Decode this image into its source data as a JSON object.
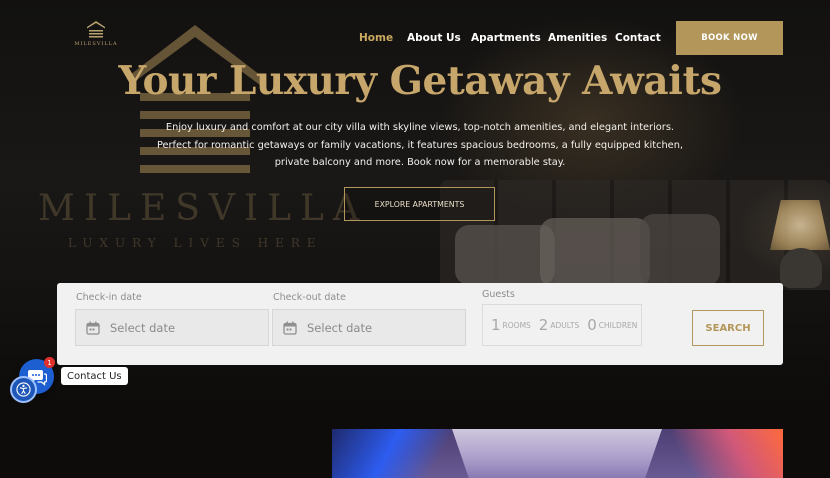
{
  "brand": {
    "logo_text": "MILESVILLA"
  },
  "nav": {
    "items": [
      {
        "label": "Home",
        "active": true
      },
      {
        "label": "About Us"
      },
      {
        "label": "Apartments"
      },
      {
        "label": "Amenities"
      },
      {
        "label": "Contact"
      }
    ],
    "book_label": "BOOK NOW"
  },
  "hero": {
    "title": "Your Luxury Getaway Awaits",
    "description": "Enjoy luxury and comfort at our city villa with skyline views, top-notch amenities, and elegant interiors. Perfect for romantic getaways or family vacations, it features spacious bedrooms, a fully equipped kitchen, private balcony and more. Book now for a memorable stay.",
    "explore_label": "EXPLORE APARTMENTS",
    "watermark": "MILESVILLA",
    "watermark_tagline": "LUXURY LIVES HERE"
  },
  "booking": {
    "checkin": {
      "label": "Check-in date",
      "placeholder": "Select date"
    },
    "checkout": {
      "label": "Check-out date",
      "placeholder": "Select date"
    },
    "guests": {
      "label": "Guests",
      "rooms": {
        "count": "1",
        "label": "ROOMS"
      },
      "adults": {
        "count": "2",
        "label": "ADULTS"
      },
      "children": {
        "count": "0",
        "label": "CHILDREN"
      }
    },
    "search_label": "SEARCH"
  },
  "chat": {
    "badge_count": "1",
    "tooltip": "Contact Us"
  },
  "colors": {
    "accent_gold": "#b3965a",
    "title_gold": "#c6a66a",
    "chat_blue": "#1d5fd1",
    "background": "#0d0c0b"
  },
  "icons": [
    "building-logo-icon",
    "calendar-icon",
    "chat-bubble-icon",
    "accessibility-icon"
  ]
}
